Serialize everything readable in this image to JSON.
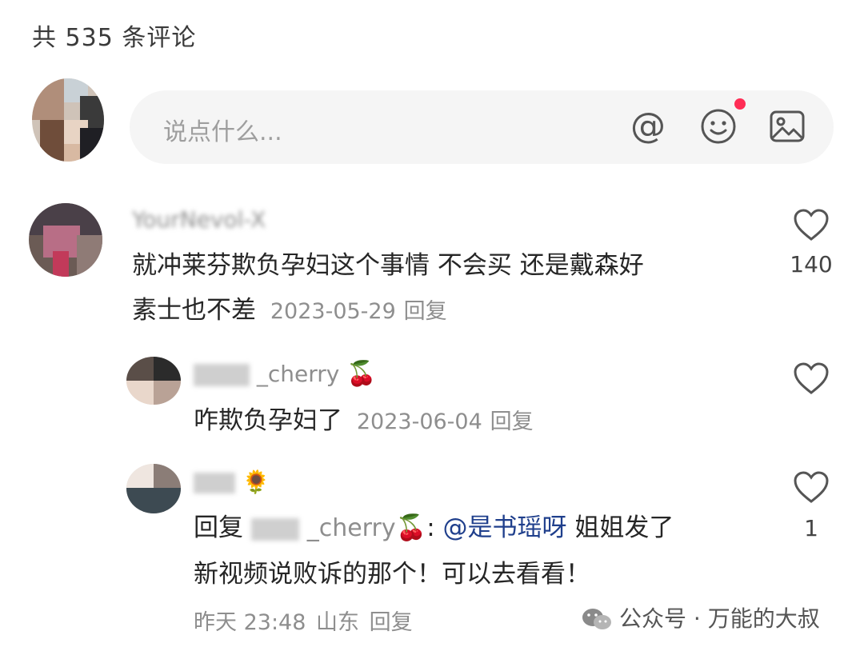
{
  "header": {
    "title": "共 535 条评论"
  },
  "input": {
    "placeholder": "说点什么...",
    "at_icon": "at-icon",
    "emoji_icon": "smile-icon",
    "image_icon": "image-icon"
  },
  "comments": [
    {
      "username": "YourNevol-X",
      "text_line1": "就冲莱芬欺负孕妇这个事情 不会买 还是戴森好",
      "text_line2": "素士也不差",
      "date": "2023-05-29",
      "reply": "回复",
      "likes": "140"
    },
    {
      "username": "_cherry",
      "emoji": "🍒",
      "text": "咋欺负孕妇了",
      "date": "2023-06-04",
      "reply": "回复",
      "likes": ""
    },
    {
      "username": "",
      "emoji": "🌻",
      "reply_prefix": "回复",
      "reply_to": "_cherry",
      "reply_to_emoji": "🍒",
      "colon": ":",
      "mention": "@是书瑶呀",
      "text_line1": " 姐姐发了",
      "text_line2": "新视频说败诉的那个！可以去看看！",
      "time": "昨天 23:48",
      "location": "山东",
      "reply": "回复",
      "likes": "1"
    }
  ],
  "watermark": {
    "text": "公众号 · 万能的大叔",
    "icon": "wechat-icon"
  }
}
